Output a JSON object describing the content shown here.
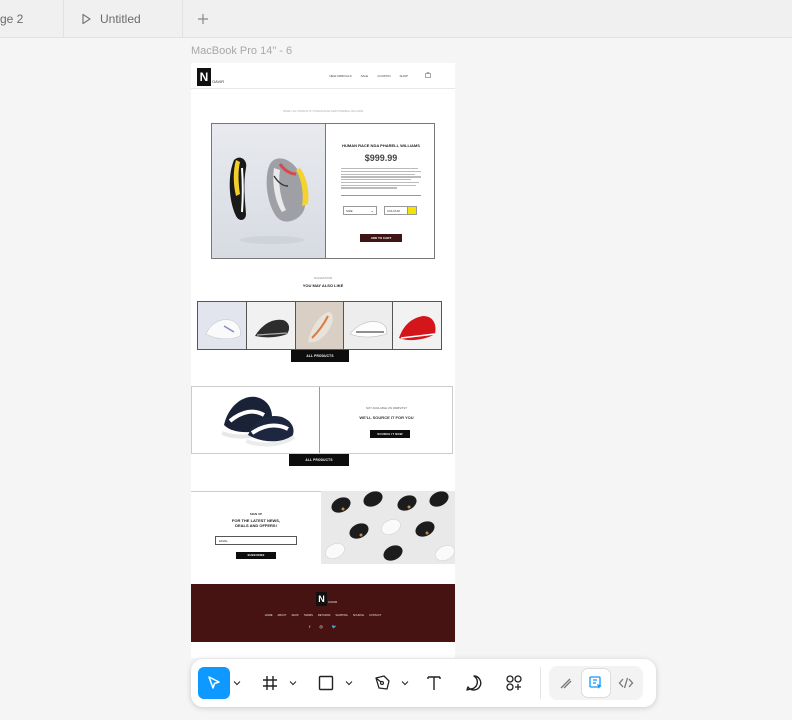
{
  "tabs": [
    {
      "label": "ge 2"
    },
    {
      "label": "Untitled"
    }
  ],
  "canvas": {
    "frame_label": "MacBook Pro 14\" - 6"
  },
  "site": {
    "logo_letter": "N",
    "logo_word": "OAVIR",
    "nav": [
      "NEW ARRIVALS",
      "SALE",
      "COUPON",
      "SHOP"
    ],
    "caption": "HOME / ALL PRODUCTS / HUMAN RACE NMD PHARRELL WILLIAMS",
    "product": {
      "title": "HUMAN RACE NDA PHARELL WILLIAMS",
      "price": "$999.99",
      "size_label": "SIZE",
      "colour_label": "COLOUR",
      "colour": "#f5e400",
      "add_to_cart": "ADD TO CART"
    },
    "also_like_kicker": "SUGGESTIONS",
    "also_like_title": "YOU MAY ALSO LIKE",
    "all_products_1": "ALL PRODUCTS",
    "source": {
      "kicker": "NOT AVAILABLE ON WEBSITE?",
      "title": "WE'LL SOURCE IT FOR YOU",
      "button": "SOURCE IT NOW"
    },
    "all_products_2": "ALL PRODUCTS",
    "signup": {
      "kicker": "SIGN UP",
      "title_line1": "FOR THE LATEST NEWS,",
      "title_line2": "DEALS AND OFFERS!",
      "input_value": "EMAIL",
      "button": "SUBSCRIBE"
    },
    "footer": {
      "logo_letter": "N",
      "logo_word": "OAVIR",
      "links": [
        "HOME",
        "ABOUT",
        "SHOP",
        "TERMS",
        "RETURNS",
        "SHIPPING",
        "SOURCE",
        "CONTACT"
      ],
      "social": [
        "f",
        "◎",
        "🐦"
      ]
    }
  },
  "toolbar": {
    "accent": "#0d99ff",
    "tools": [
      "move-tool",
      "frame-tool",
      "rectangle-tool",
      "pen-tool",
      "text-tool",
      "comment-tool",
      "actions-tool"
    ],
    "modes": [
      "draw-mode",
      "design-mode",
      "dev-mode"
    ]
  }
}
